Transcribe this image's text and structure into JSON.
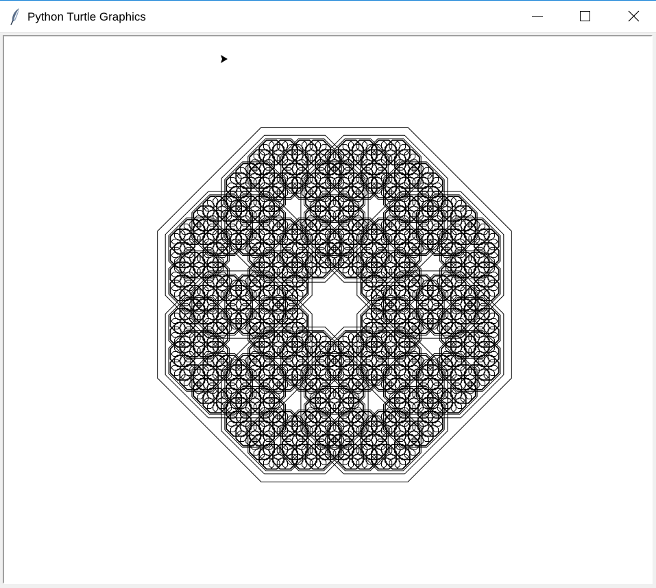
{
  "window": {
    "title": "Python Turtle Graphics",
    "app_icon": "feather-icon",
    "controls": {
      "minimize": "minimize-icon",
      "maximize": "maximize-icon",
      "close": "close-icon"
    }
  },
  "canvas": {
    "background": "#ffffff",
    "pen_color": "#000000",
    "drawing": "nested octagon fractal",
    "recursion_depth": 4,
    "cursor": "turtle-arrow-icon"
  }
}
